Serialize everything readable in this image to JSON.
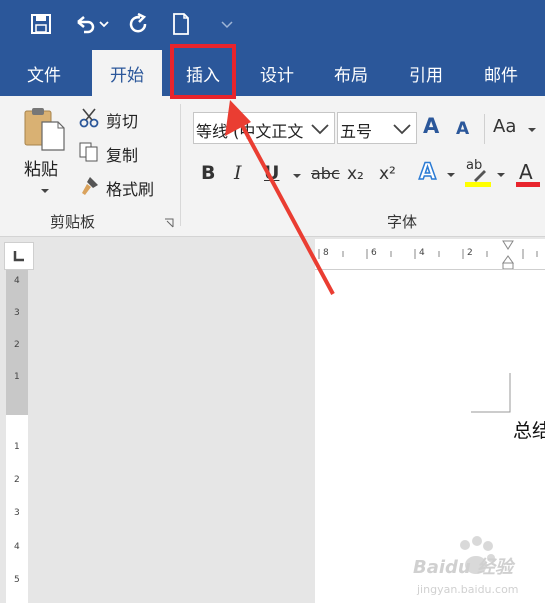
{
  "tabs": [
    "文件",
    "开始",
    "插入",
    "设计",
    "布局",
    "引用",
    "邮件"
  ],
  "clipboard": {
    "paste": "粘贴",
    "cut": "剪切",
    "copy": "复制",
    "format_painter": "格式刷",
    "group_label": "剪贴板"
  },
  "font": {
    "font_name": "等线 (中文正文",
    "font_size": "五号",
    "group_label": "字体",
    "change_case": "Aa",
    "bold": "B",
    "italic": "I",
    "underline": "U",
    "strike": "abc",
    "subscript": "x₂",
    "superscript": "x²",
    "text_effects": "A",
    "highlight": "ab",
    "font_color": "A",
    "grow": "A",
    "shrink": "A"
  },
  "hruler": {
    "numbers": [
      "8",
      "6",
      "4",
      "2"
    ]
  },
  "vruler": {
    "gray_numbers": [
      "4",
      "3",
      "2",
      "1"
    ],
    "white_numbers": [
      "1",
      "2",
      "3",
      "4",
      "5"
    ]
  },
  "document": {
    "text": "总结"
  },
  "watermark": {
    "brand": "Baidu 经验",
    "url": "jingyan.baidu.com"
  },
  "colors": {
    "title_bar": "#2b579a",
    "highlight_box": "#e8242c",
    "font_color_bar": "#e8242c",
    "highlight_color_bar": "#ffff00"
  }
}
